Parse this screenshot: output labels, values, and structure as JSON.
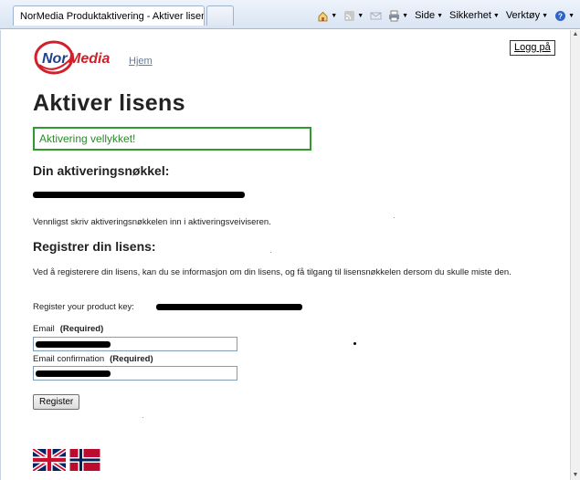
{
  "browser": {
    "tab_title": "NorMedia Produktaktivering - Aktiver lisens",
    "commands": {
      "page": "Side",
      "safety": "Sikkerhet",
      "tools": "Verktøy"
    }
  },
  "header": {
    "logo_text": "NorMedia",
    "home_link": "Hjem",
    "login_button": "Logg på"
  },
  "main": {
    "title": "Aktiver lisens",
    "success_message": "Aktivering vellykket!",
    "key_heading": "Din aktiveringsnøkkel:",
    "key_instruction": "Vennligst skriv aktiveringsnøkkelen inn i aktiveringsveiviseren.",
    "register_heading": "Registrer din lisens:",
    "register_info": "Ved å registerere din lisens, kan du se informasjon om din lisens, og få tilgang til lisensnøkkelen dersom du skulle miste den.",
    "product_key_label": "Register your product key:",
    "email_label": "Email",
    "email_required": "(Required)",
    "email_confirm_label": "Email confirmation",
    "email_confirm_required": "(Required)",
    "register_button": "Register"
  },
  "colors": {
    "success_border": "#2f9a2f",
    "logo_red": "#d0202a",
    "logo_blue": "#1f3f8f"
  }
}
